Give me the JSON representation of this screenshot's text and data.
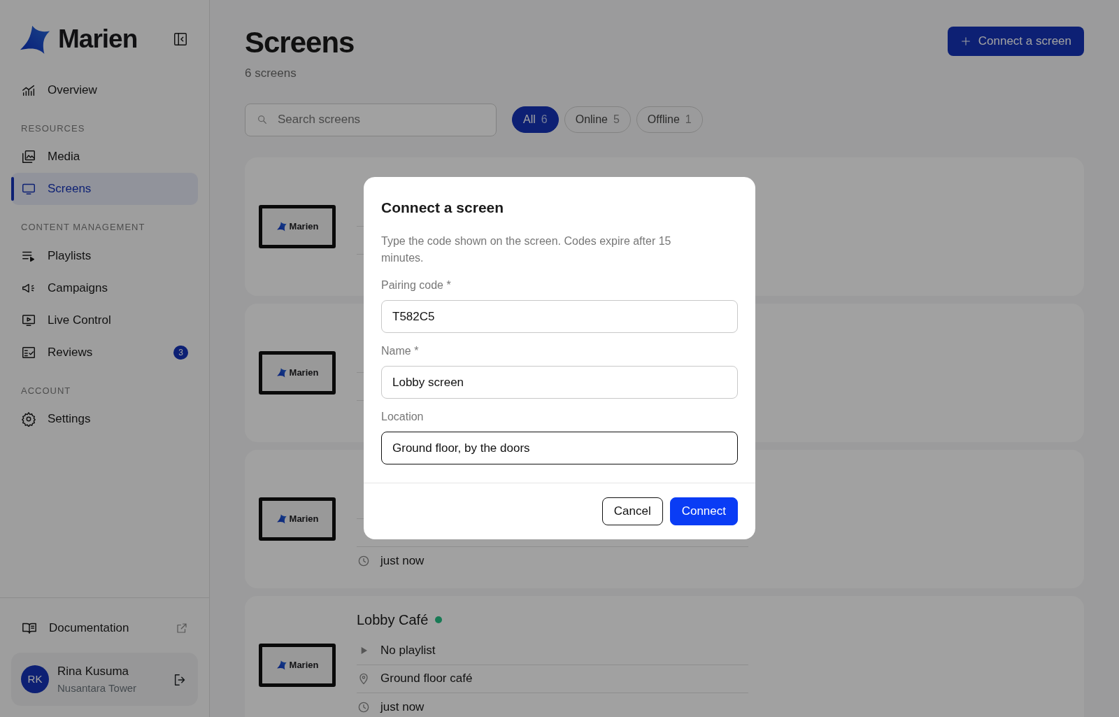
{
  "sidebar": {
    "brand": "Marien",
    "sections": [
      {
        "items": [
          {
            "label": "Overview",
            "selected": false
          }
        ]
      },
      {
        "heading": "RESOURCES",
        "items": [
          {
            "label": "Media",
            "selected": false
          },
          {
            "label": "Screens",
            "selected": true
          }
        ]
      },
      {
        "heading": "CONTENT MANAGEMENT",
        "items": [
          {
            "label": "Playlists",
            "selected": false
          },
          {
            "label": "Campaigns",
            "selected": false
          },
          {
            "label": "Live Control",
            "selected": false
          },
          {
            "label": "Reviews",
            "selected": false,
            "badge": "3"
          }
        ]
      },
      {
        "heading": "ACCOUNT",
        "items": [
          {
            "label": "Settings",
            "selected": false
          }
        ]
      }
    ],
    "footer_link": {
      "label": "Documentation"
    },
    "user": {
      "initials": "RK",
      "name": "Rina Kusuma",
      "subtitle": "Nusantara Tower"
    }
  },
  "main": {
    "title": "Screens",
    "subtitle": "6 screens",
    "primary_button": "Connect a screen",
    "search": {
      "placeholder": "Search screens"
    },
    "filters": [
      {
        "label": "All",
        "count": "6",
        "selected": true
      },
      {
        "label": "Online",
        "count": "5",
        "selected": false
      },
      {
        "label": "Offline",
        "count": "1",
        "selected": false
      }
    ],
    "cards": [
      {
        "thumbnail_text": "Marien"
      },
      {
        "thumbnail_text": "Marien"
      },
      {
        "thumbnail_text": "Marien",
        "rows": [
          {
            "kind": "time",
            "text": "just now"
          }
        ]
      },
      {
        "title": "Lobby Café",
        "color": "#187a55",
        "thumbnail_text": "Marien",
        "rows": [
          {
            "kind": "playlist",
            "text": "No playlist"
          },
          {
            "kind": "location",
            "text": "Ground floor café"
          },
          {
            "kind": "time",
            "text": "just now"
          }
        ]
      }
    ]
  },
  "modal": {
    "title": "Connect a screen",
    "description": "Type the code shown on the screen. Codes expire after 15 minutes.",
    "fields": [
      {
        "label": "Pairing code *",
        "value": "T582C5",
        "focused": false
      },
      {
        "label": "Name *",
        "value": "Lobby screen",
        "focused": false
      },
      {
        "label": "Location",
        "value": "Ground floor, by the doors",
        "focused": true
      }
    ],
    "buttons": [
      {
        "label": "Cancel",
        "kind": "secondary"
      },
      {
        "label": "Connect",
        "kind": "primary"
      }
    ]
  }
}
